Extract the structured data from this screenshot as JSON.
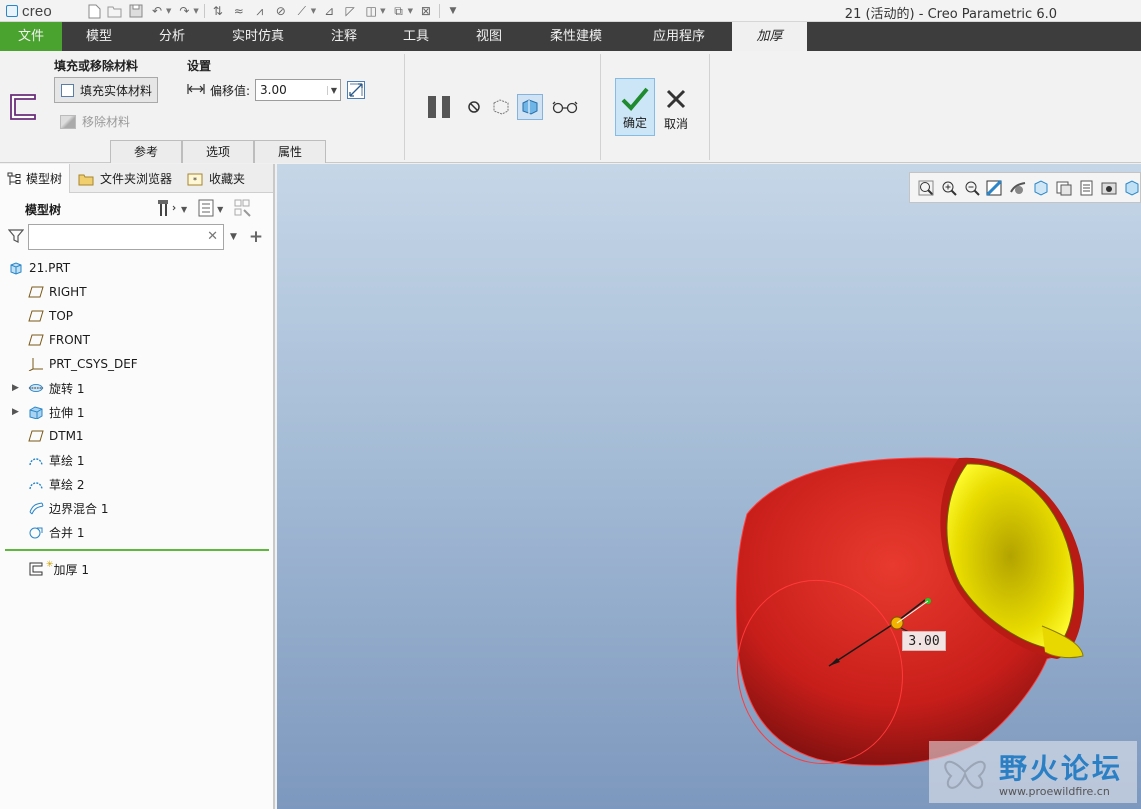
{
  "app": {
    "logo_text": "creo",
    "window_title": "21 (活动的) - Creo Parametric 6.0"
  },
  "ribbon_tabs": [
    {
      "label": "文件"
    },
    {
      "label": "模型"
    },
    {
      "label": "分析"
    },
    {
      "label": "实时仿真"
    },
    {
      "label": "注释"
    },
    {
      "label": "工具"
    },
    {
      "label": "视图"
    },
    {
      "label": "柔性建模"
    },
    {
      "label": "应用程序"
    },
    {
      "label": "加厚"
    }
  ],
  "ribbon": {
    "group_fill_label": "填充或移除材料",
    "fill_solid_label": "填充实体材料",
    "remove_material_label": "移除材料",
    "group_settings_label": "设置",
    "offset_label": "偏移值:",
    "offset_value": "3.00",
    "subtabs": [
      "参考",
      "选项",
      "属性"
    ],
    "ok_label": "确定",
    "cancel_label": "取消"
  },
  "left_panel": {
    "tabs": [
      {
        "label": "模型树"
      },
      {
        "label": "文件夹浏览器"
      },
      {
        "label": "收藏夹"
      }
    ],
    "tree_header": "模型树",
    "search_value": "",
    "tree_items": [
      {
        "label": "21.PRT",
        "icon": "part-icon"
      },
      {
        "label": "RIGHT",
        "icon": "datum-plane-icon"
      },
      {
        "label": "TOP",
        "icon": "datum-plane-icon"
      },
      {
        "label": "FRONT",
        "icon": "datum-plane-icon"
      },
      {
        "label": "PRT_CSYS_DEF",
        "icon": "csys-icon"
      },
      {
        "label": "旋转 1",
        "icon": "revolve-icon"
      },
      {
        "label": "拉伸 1",
        "icon": "extrude-icon"
      },
      {
        "label": "DTM1",
        "icon": "datum-plane-icon"
      },
      {
        "label": "草绘 1",
        "icon": "sketch-icon"
      },
      {
        "label": "草绘 2",
        "icon": "sketch-icon"
      },
      {
        "label": "边界混合 1",
        "icon": "boundary-blend-icon"
      },
      {
        "label": "合并 1",
        "icon": "merge-icon"
      }
    ],
    "active_feature": {
      "label": "加厚 1",
      "icon": "thicken-icon"
    }
  },
  "viewport": {
    "dimension_value": "3.00",
    "watermark_title": "野火论坛",
    "watermark_url": "www.proewildfire.cn"
  }
}
